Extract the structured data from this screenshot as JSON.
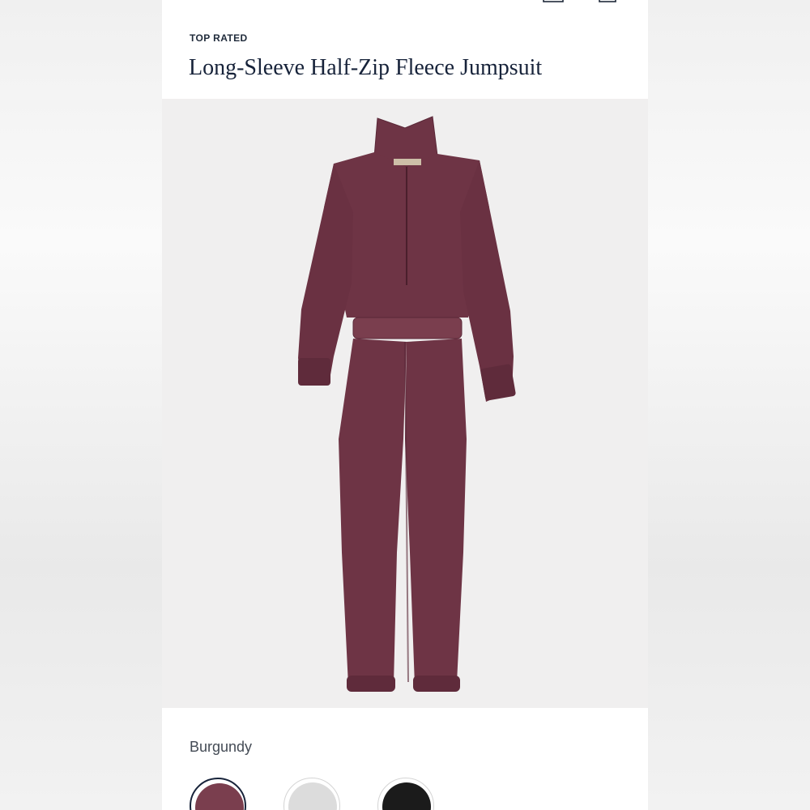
{
  "product": {
    "badge": "TOP RATED",
    "title": "Long-Sleeve Half-Zip Fleece Jumpsuit",
    "selected_color": "Burgundy"
  },
  "icons": {
    "back": "chevron-left-icon",
    "account": "account-icon",
    "bag": "shopping-bag-icon"
  },
  "swatches": [
    {
      "name": "burgundy",
      "color": "#7a3e4e",
      "selected": true
    },
    {
      "name": "light-gray",
      "color": "#dcdcdc",
      "selected": false
    },
    {
      "name": "black",
      "color": "#1b1b1b",
      "selected": false
    }
  ],
  "colors": {
    "garment": "#6e3445",
    "garment_shadow": "#5a2838",
    "garment_highlight": "#85475a",
    "image_bg": "#f0efef",
    "title_text": "#17233a"
  }
}
